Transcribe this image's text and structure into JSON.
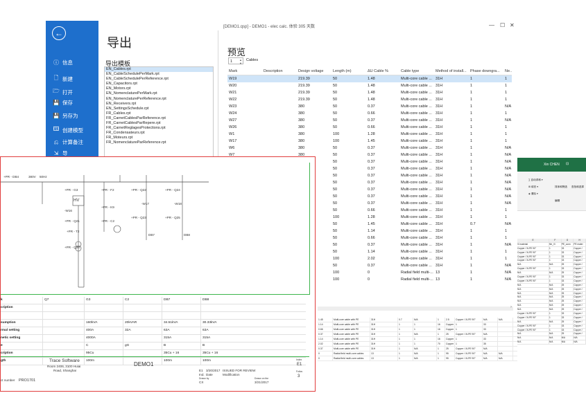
{
  "window": {
    "title": "[DEMO1.qsp] - DEMO1 - elec calc. 体验 305 天数",
    "minimize": "—",
    "maximize": "☐",
    "close": "✕"
  },
  "sidebar": {
    "back": "←",
    "items": [
      {
        "icon": "ⓘ",
        "label": "信息"
      },
      {
        "icon": "🗋",
        "label": "新建"
      },
      {
        "icon": "🗁",
        "label": "打开"
      },
      {
        "icon": "💾",
        "label": "保存"
      },
      {
        "icon": "💾",
        "label": "另存为"
      },
      {
        "icon": "🖽",
        "label": "创建模型"
      },
      {
        "icon": "⎌",
        "label": "计算备注"
      },
      {
        "icon": "⇲",
        "label": "导"
      }
    ]
  },
  "export": {
    "heading": "导出",
    "templates_label": "导出模板",
    "templates": [
      "EN_Cables.rpt",
      "EN_CableSchedulePerMark.rpt",
      "EN_CableSchedulePerReference.rpt",
      "EN_Capacitors.rpt",
      "EN_Motors.rpt",
      "EN_NomenclaturePerMark.rpt",
      "EN_NomenclaturePerReference.rpt",
      "EN_Receivers.rpt",
      "EN_SettingsSchedule.rpt",
      "FR_Cables.rpt",
      "FR_CarnetCablesParReference.rpt",
      "FR_CarnetCablesParRepere.rpt",
      "FR_CarnetReglagesProtections.rpt",
      "FR_Condensateurs.rpt",
      "FR_Moteurs.rpt",
      "FR_NomenclatureParReference.rpt"
    ]
  },
  "preview": {
    "heading": "预览",
    "page": "1",
    "cables_label": "Cables",
    "columns": [
      "Mark",
      "Description",
      "Design voltage",
      "Length (m)",
      "ΔU Cable %",
      "Cable type",
      "Method of install...",
      "Phase downgra...",
      "Ne..."
    ],
    "rows": [
      [
        "W19",
        "",
        "219.39",
        "50",
        "1.48",
        "Multi-core cable ...",
        "31H",
        "1",
        "1"
      ],
      [
        "W20",
        "",
        "219.39",
        "50",
        "1.48",
        "Multi-core cable ...",
        "31H",
        "1",
        "1"
      ],
      [
        "W21",
        "",
        "219.39",
        "50",
        "1.48",
        "Multi-core cable ...",
        "31H",
        "1",
        "1"
      ],
      [
        "W22",
        "",
        "219.39",
        "50",
        "1.48",
        "Multi-core cable ...",
        "31H",
        "1",
        "1"
      ],
      [
        "W23",
        "",
        "380",
        "50",
        "0.37",
        "Multi-core cable ...",
        "31H",
        "1",
        "N/A"
      ],
      [
        "W24",
        "",
        "380",
        "50",
        "0.66",
        "Multi-core cable ...",
        "31H",
        "1",
        "1"
      ],
      [
        "W27",
        "",
        "380",
        "50",
        "0.37",
        "Multi-core cable ...",
        "31H",
        "1",
        "N/A"
      ],
      [
        "W26",
        "",
        "380",
        "50",
        "0.66",
        "Multi-core cable ...",
        "31H",
        "1",
        "1"
      ],
      [
        "W1",
        "",
        "380",
        "100",
        "1.28",
        "Multi-core cable ...",
        "31H",
        "1",
        "1"
      ],
      [
        "W17",
        "",
        "380",
        "100",
        "1.45",
        "Multi-core cable ...",
        "31H",
        "1",
        "1"
      ],
      [
        "W6",
        "",
        "380",
        "50",
        "0.37",
        "Multi-core cable ...",
        "31H",
        "1",
        "N/A"
      ],
      [
        "W7",
        "",
        "380",
        "50",
        "0.37",
        "Multi-core cable ...",
        "31H",
        "1",
        "N/A"
      ],
      [
        "",
        "",
        "",
        "50",
        "0.37",
        "Multi-core cable ...",
        "31H",
        "1",
        "N/A"
      ],
      [
        "",
        "",
        "",
        "50",
        "0.37",
        "Multi-core cable ...",
        "31H",
        "1",
        "N/A"
      ],
      [
        "",
        "",
        "",
        "50",
        "0.37",
        "Multi-core cable ...",
        "31H",
        "1",
        "N/A"
      ],
      [
        "",
        "",
        "",
        "50",
        "0.37",
        "Multi-core cable ...",
        "31H",
        "1",
        "N/A"
      ],
      [
        "",
        "",
        "",
        "50",
        "0.37",
        "Multi-core cable ...",
        "31H",
        "1",
        "N/A"
      ],
      [
        "",
        "",
        "",
        "50",
        "0.37",
        "Multi-core cable ...",
        "31H",
        "1",
        "N/A"
      ],
      [
        "",
        "",
        "",
        "50",
        "0.37",
        "Multi-core cable ...",
        "31H",
        "1",
        "N/A"
      ],
      [
        "",
        "",
        "",
        "50",
        "0.66",
        "Multi-core cable ...",
        "31H",
        "1",
        "1"
      ],
      [
        "",
        "",
        "",
        "100",
        "1.28",
        "Multi-core cable ...",
        "31H",
        "1",
        "1"
      ],
      [
        "",
        "",
        "",
        "50",
        "1.45",
        "Multi-core cable ...",
        "31H",
        "0.7",
        "N/A"
      ],
      [
        "",
        "",
        "",
        "50",
        "1.14",
        "Multi-core cable ...",
        "31H",
        "1",
        "1"
      ],
      [
        "",
        "",
        "",
        "50",
        "0.66",
        "Multi-core cable ...",
        "31H",
        "1",
        "1"
      ],
      [
        "",
        "",
        "",
        "50",
        "0.37",
        "Multi-core cable ...",
        "31H",
        "1",
        "N/A"
      ],
      [
        "",
        "",
        "",
        "50",
        "1.14",
        "Multi-core cable ...",
        "31H",
        "1",
        "1"
      ],
      [
        "",
        "",
        "",
        "100",
        "2.02",
        "Multi-core cable ...",
        "31H",
        "1",
        "1"
      ],
      [
        "",
        "",
        "",
        "50",
        "0.37",
        "Multi-core cable ...",
        "31H",
        "1",
        "N/A"
      ],
      [
        "",
        "",
        "",
        "100",
        "0",
        "Radial field multi-...",
        "13",
        "1",
        "N/A"
      ],
      [
        "",
        "",
        "",
        "100",
        "0",
        "Radial field multi-...",
        "13",
        "1",
        "N/A"
      ]
    ]
  },
  "drawing": {
    "top_label": "+PR - DB4",
    "voltage": "380V",
    "frequency": "50Hz",
    "prop_labels": [
      "k",
      "cription",
      "",
      "sumption",
      "rmal setting",
      "netic setting",
      "e",
      "cription",
      "gth"
    ],
    "prop_columns": [
      [
        "Q7",
        "",
        "",
        "",
        "",
        "",
        "",
        "",
        ""
      ],
      [
        "G3",
        "",
        "",
        "160kVA",
        "400A",
        "4000A",
        "C",
        "95Cu",
        "100m"
      ],
      [
        "C2",
        "",
        "",
        "20kVAR",
        "32A",
        "",
        "gG",
        "",
        ""
      ],
      [
        "DB7",
        "",
        "",
        "34.51kVA",
        "63A",
        "315A",
        "B",
        "35Cu + 16",
        "100m"
      ],
      [
        "DB8",
        "",
        "",
        "30.33kVA",
        "63A",
        "315A",
        "B",
        "35Cu + 16",
        "100m"
      ]
    ],
    "company": "Trace Software",
    "address1": "Room 2406, 3100 Huiai",
    "address2": "Road, Shanghai",
    "project": "DEMO1",
    "revision_row": [
      "E1",
      "3/20/2017",
      "ISSUED FOR REVIEW"
    ],
    "revision_headers": [
      "Ind.",
      "Date",
      "Modification"
    ],
    "drawn_by_label": "Drawn by",
    "drawn_by": "CX",
    "drawn_on_label": "Drawn on the",
    "drawn_on": "3/21/2017",
    "index_label": "Index",
    "index": "E1",
    "folio_label": "Folios",
    "folio": "3",
    "project_number_label": "ct number",
    "project_number": "PRO1701",
    "symbols": {
      "hv": "HV",
      "g3": "+PR - G3",
      "w16": "-W16",
      "q21": "+PR - Q21",
      "t2": "+PR - T2",
      "q20": "+PR - Q20",
      "f2": "+PR - F2",
      "k9": "+PR - K9",
      "c2": "+PR - C2",
      "q22": "+PR - Q22",
      "w17": "-W17",
      "q23": "+PR - Q23",
      "q24": "+PR - Q24",
      "w18": "-W18",
      "q25": "+PR - Q25",
      "db7": "DB7",
      "db8": "DB8"
    }
  },
  "excel": {
    "user": "Xin CHEN",
    "ribbon": [
      "∑ 自动求和 ▾",
      "⊞ 填充 ▾",
      "◈ 清除 ▾",
      "排序和筛选",
      "查找和选择",
      "编辑"
    ],
    "cols": [
      "E",
      "F",
      "G",
      "H"
    ],
    "rows": [
      [
        "Vi material",
        "Nb_Vi",
        "PE_conn",
        "PE mater"
      ],
      [
        "Copper / XLPE 90°",
        "1",
        "33",
        "Copper /"
      ],
      [
        "Copper / XLPE 90°",
        "1",
        "33",
        "Copper /"
      ],
      [
        "Copper / XLPE 90°",
        "1",
        "33",
        "Copper /"
      ],
      [
        "Copper / XLPE 90°",
        "1",
        "33",
        "Copper /"
      ],
      [
        "N/A",
        "N/A",
        "25",
        "Copper /"
      ],
      [
        "Copper / XLPE 90°",
        "1",
        "33",
        "Copper /"
      ],
      [
        "N/A",
        "N/A",
        "25",
        "Copper /"
      ],
      [
        "Copper / XLPE 90°",
        "1",
        "33",
        "Copper /"
      ],
      [
        "Copper / XLPE 90°",
        "1",
        "33",
        "Copper /"
      ],
      [
        "N/A",
        "N/A",
        "25",
        "Copper /"
      ],
      [
        "N/A",
        "N/A",
        "25",
        "Copper /"
      ],
      [
        "N/A",
        "N/A",
        "25",
        "Copper /"
      ],
      [
        "N/A",
        "N/A",
        "25",
        "Copper /"
      ],
      [
        "N/A",
        "N/A",
        "25",
        "Copper /"
      ],
      [
        "N/A",
        "N/A",
        "25",
        "Copper /"
      ],
      [
        "N/A",
        "N/A",
        "25",
        "Copper /"
      ],
      [
        "Copper / XLPE 90°",
        "1",
        "33",
        "Copper /"
      ],
      [
        "Copper / XLPE 90°",
        "1",
        "33",
        "Copper /"
      ],
      [
        "N/A",
        "N/A",
        "25",
        "Copper /"
      ],
      [
        "Copper / XLPE 90°",
        "1",
        "33",
        "Copper /"
      ],
      [
        "Copper / XLPE 90°",
        "1",
        "33",
        "Copper /"
      ],
      [
        "N/A",
        "N/A",
        "25",
        "Copper /"
      ],
      [
        "N/A",
        "N/A",
        "N/A",
        "N/A"
      ],
      [
        "N/A",
        "N/A",
        "N/A",
        "N/A"
      ]
    ]
  },
  "strip": {
    "rows": [
      [
        "1.45",
        "Multi-core cable with PE",
        "31H",
        "0.7",
        "N/A",
        "1",
        "2.5",
        "Copper / XLPE 90°",
        "N/A",
        "N/A"
      ],
      [
        "1.14",
        "Multi-core cable with PE",
        "31H",
        "1",
        "1",
        "16",
        "Copper / XLPE 90°",
        "1",
        "33",
        ""
      ],
      [
        "0.66",
        "Multi-core cable with PE",
        "31H",
        "1",
        "1",
        "16",
        "Copper / XLPE 90°",
        "1",
        "33",
        ""
      ],
      [
        "0.37",
        "Multi-core cable with PE",
        "31H",
        "1",
        "N/A",
        "1",
        "25",
        "Copper / XLPE 90°",
        "N/A",
        ""
      ],
      [
        "1.14",
        "Multi-core cable with PE",
        "31H",
        "1",
        "1",
        "16",
        "Copper / XLPE 90°",
        "1",
        "33",
        ""
      ],
      [
        "2.02",
        "Multi-core cable with PE",
        "31H",
        "1",
        "1",
        "70",
        "Copper / XLPE 90°",
        "1",
        "35",
        ""
      ],
      [
        "0.37",
        "Multi-core cable with PE",
        "31H",
        "1",
        "N/A",
        "1",
        "25",
        "Copper / XLPE 90°",
        "N/A",
        ""
      ],
      [
        "0",
        "Radial field multi-core cables",
        "13",
        "1",
        "N/A",
        "1",
        "95",
        "Copper / XLPE 90°",
        "N/A",
        "N/A"
      ],
      [
        "0",
        "Radial field multi-core cables",
        "13",
        "1",
        "N/A",
        "1",
        "95",
        "Copper / XLPE 90°",
        "N/A",
        "N/A"
      ]
    ]
  },
  "colors": {
    "sidebar": "#1e6fcc",
    "selection": "#cfe4f8",
    "excel_green": "#1f7145",
    "sheet_border_red": "#e03c3c",
    "sheet_border_green": "#3bb54a"
  }
}
